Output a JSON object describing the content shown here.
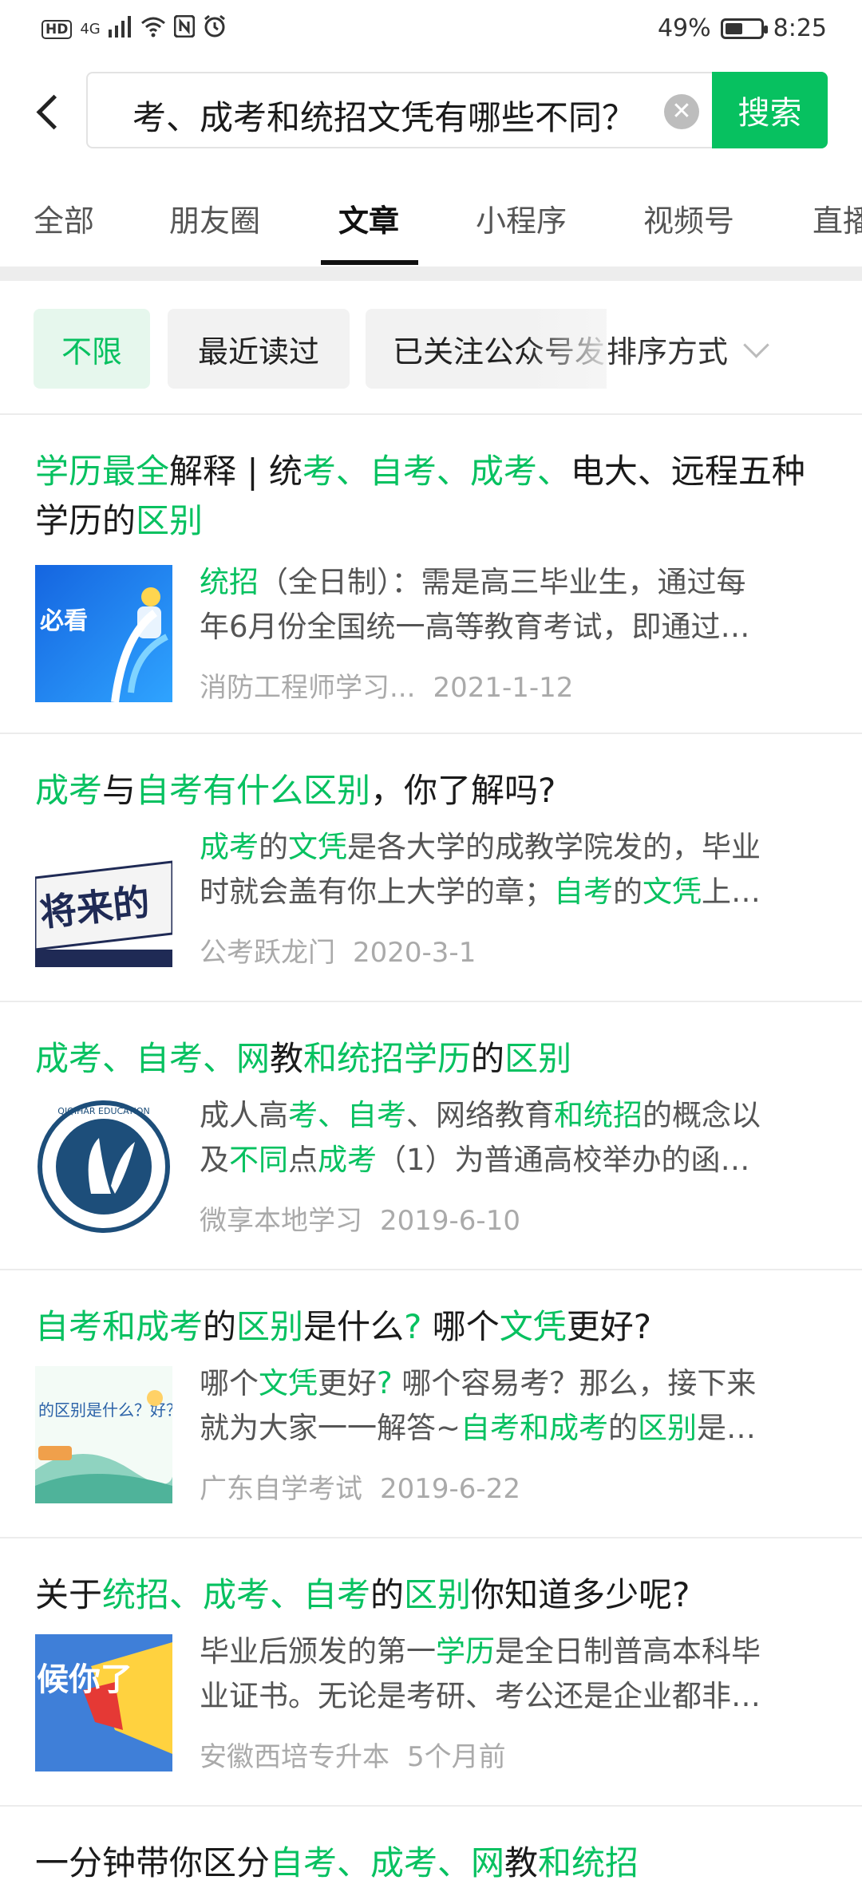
{
  "status_bar": {
    "left_badges": [
      "HD",
      "4G"
    ],
    "battery_percent": "49%",
    "battery_level": 0.49,
    "time": "8:25"
  },
  "header": {
    "query": "考、成考和统招文凭有哪些不同？",
    "search_button": "搜索"
  },
  "tabs": [
    "全部",
    "朋友圈",
    "文章",
    "小程序",
    "视频号",
    "直播"
  ],
  "active_tab": "文章",
  "filters": {
    "chips": [
      "不限",
      "最近读过",
      "已关注公众号发布"
    ],
    "sort_label": "排序方式"
  },
  "results": [
    {
      "title_parts": [
        {
          "t": "学历最全",
          "hl": true
        },
        {
          "t": "解释 | 统",
          "hl": false
        },
        {
          "t": "考、自考、成考、",
          "hl": true
        },
        {
          "t": "电大、远程五种学历的",
          "hl": false
        },
        {
          "t": "区别",
          "hl": true
        }
      ],
      "snippet_lines": [
        [
          {
            "t": "统招",
            "hl": true
          },
          {
            "t": "（全日制）：需是高三毕业生，通过每",
            "hl": false
          }
        ],
        [
          {
            "t": "年6月份全国统一高等教育考试，即通过…",
            "hl": false
          }
        ]
      ],
      "source": "消防工程师学习...",
      "date": "2021-1-12",
      "thumb_text": "必看"
    },
    {
      "title_parts": [
        {
          "t": "成考",
          "hl": true
        },
        {
          "t": "与",
          "hl": false
        },
        {
          "t": "自考有什么区别",
          "hl": true
        },
        {
          "t": "，你了解吗?",
          "hl": false
        }
      ],
      "snippet_lines": [
        [
          {
            "t": "成考",
            "hl": true
          },
          {
            "t": "的",
            "hl": false
          },
          {
            "t": "文凭",
            "hl": true
          },
          {
            "t": "是各大学的成教学院发的，毕业",
            "hl": false
          }
        ],
        [
          {
            "t": "时就会盖有你上大学的章；",
            "hl": false
          },
          {
            "t": "自考",
            "hl": true
          },
          {
            "t": "的",
            "hl": false
          },
          {
            "t": "文凭",
            "hl": true
          },
          {
            "t": "上…",
            "hl": false
          }
        ]
      ],
      "source": "公考跃龙门",
      "date": "2020-3-1",
      "thumb_text": "将来的"
    },
    {
      "title_parts": [
        {
          "t": "成考、自考、网",
          "hl": true
        },
        {
          "t": "教",
          "hl": false
        },
        {
          "t": "和统招学历",
          "hl": true
        },
        {
          "t": "的",
          "hl": false
        },
        {
          "t": "区别",
          "hl": true
        }
      ],
      "snippet_lines": [
        [
          {
            "t": "成人高",
            "hl": false
          },
          {
            "t": "考、自考",
            "hl": true
          },
          {
            "t": "、网络教育",
            "hl": false
          },
          {
            "t": "和统招",
            "hl": true
          },
          {
            "t": "的概念以",
            "hl": false
          }
        ],
        [
          {
            "t": "及",
            "hl": false
          },
          {
            "t": "不同",
            "hl": true
          },
          {
            "t": "点",
            "hl": false
          },
          {
            "t": "成考",
            "hl": true
          },
          {
            "t": "（1）为普通高校举办的函…",
            "hl": false
          }
        ]
      ],
      "source": "微享本地学习",
      "date": "2019-6-10",
      "thumb_text": "QIQIHAR EDUCATION"
    },
    {
      "title_parts": [
        {
          "t": "自考和成考",
          "hl": true
        },
        {
          "t": "的",
          "hl": false
        },
        {
          "t": "区别",
          "hl": true
        },
        {
          "t": "是什么",
          "hl": false
        },
        {
          "t": "?",
          "hl": true
        },
        {
          "t": " 哪个",
          "hl": false
        },
        {
          "t": "文凭",
          "hl": true
        },
        {
          "t": "更好?",
          "hl": false
        }
      ],
      "snippet_lines": [
        [
          {
            "t": "哪个",
            "hl": false
          },
          {
            "t": "文凭",
            "hl": true
          },
          {
            "t": "更好",
            "hl": false
          },
          {
            "t": "?",
            "hl": true
          },
          {
            "t": " 哪个容易考？那么，接下来",
            "hl": false
          }
        ],
        [
          {
            "t": "就为大家一一解答~",
            "hl": false
          },
          {
            "t": "自考和成考",
            "hl": true
          },
          {
            "t": "的",
            "hl": false
          },
          {
            "t": "区别",
            "hl": true
          },
          {
            "t": "是…",
            "hl": false
          }
        ]
      ],
      "source": "广东自学考试",
      "date": "2019-6-22",
      "thumb_text": "的区别是什么？好？"
    },
    {
      "title_parts": [
        {
          "t": "关于",
          "hl": false
        },
        {
          "t": "统招、成考、自考",
          "hl": true
        },
        {
          "t": "的",
          "hl": false
        },
        {
          "t": "区别",
          "hl": true
        },
        {
          "t": "你知道多少呢?",
          "hl": false
        }
      ],
      "snippet_lines": [
        [
          {
            "t": "毕业后颁发的第一",
            "hl": false
          },
          {
            "t": "学历",
            "hl": true
          },
          {
            "t": "是全日制普高本科毕",
            "hl": false
          }
        ],
        [
          {
            "t": "业证书。无论是考研、考公还是企业都非…",
            "hl": false
          }
        ]
      ],
      "source": "安徽西培专升本",
      "date": "5个月前",
      "thumb_text": "候你了"
    },
    {
      "title_parts": [
        {
          "t": "一分钟带你区分",
          "hl": false
        },
        {
          "t": "自考、成考、网",
          "hl": true
        },
        {
          "t": "教",
          "hl": false
        },
        {
          "t": "和统招",
          "hl": true
        }
      ],
      "snippet_lines": [],
      "source": "",
      "date": "",
      "thumb_text": ""
    }
  ]
}
